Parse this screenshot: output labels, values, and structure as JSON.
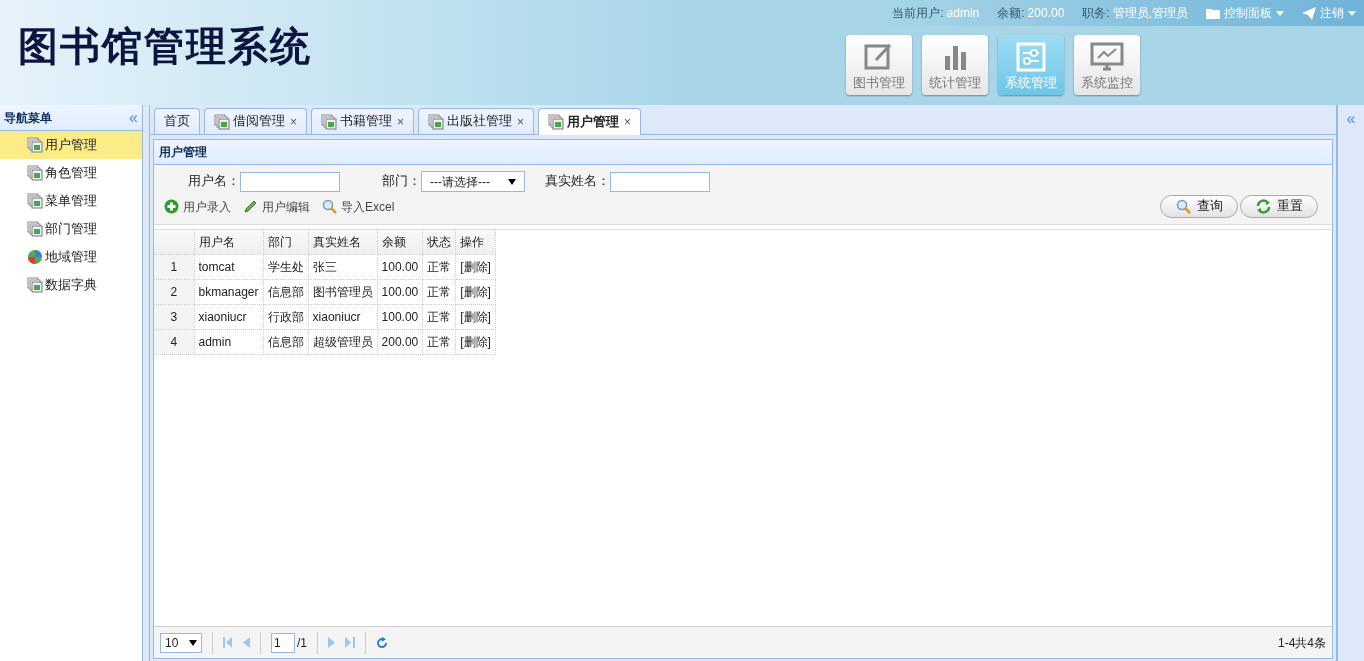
{
  "header": {
    "logo": "图书馆管理系统",
    "user_info": [
      {
        "label": "当前用户:",
        "value": "admin"
      },
      {
        "label": "余额:",
        "value": "200.00"
      },
      {
        "label": "职务:",
        "value": "管理员,管理员"
      }
    ],
    "menus": [
      {
        "kind": "folder",
        "label": "控制面板"
      },
      {
        "kind": "send",
        "label": "注销"
      }
    ],
    "modules": [
      {
        "kind": "edit",
        "label": "图书管理",
        "selected": false
      },
      {
        "kind": "chart",
        "label": "统计管理",
        "selected": false
      },
      {
        "kind": "settings",
        "label": "系统管理",
        "selected": true
      },
      {
        "kind": "monitor",
        "label": "系统监控",
        "selected": false
      }
    ]
  },
  "sidebar": {
    "title": "导航菜单",
    "collapse": "«",
    "items": [
      {
        "kind": "page",
        "label": "用户管理",
        "selected": true
      },
      {
        "kind": "page",
        "label": "角色管理",
        "selected": false
      },
      {
        "kind": "page",
        "label": "菜单管理",
        "selected": false
      },
      {
        "kind": "page",
        "label": "部门管理",
        "selected": false
      },
      {
        "kind": "globe",
        "label": "地域管理",
        "selected": false
      },
      {
        "kind": "page",
        "label": "数据字典",
        "selected": false
      }
    ]
  },
  "tabs": [
    {
      "label": "首页",
      "selected": false
    },
    {
      "label": "借阅管理",
      "selected": false,
      "close": "×"
    },
    {
      "label": "书籍管理",
      "selected": false,
      "close": "×"
    },
    {
      "label": "出版社管理",
      "selected": false,
      "close": "×"
    },
    {
      "label": "用户管理",
      "selected": true,
      "close": "×"
    }
  ],
  "right_panel": {
    "expand": "«"
  },
  "panel": {
    "title": "用户管理",
    "search": [
      {
        "kind": "text",
        "label": "用户名："
      },
      {
        "kind": "select",
        "label": "部门：",
        "value": "---请选择---"
      },
      {
        "kind": "text",
        "label": "真实姓名："
      }
    ],
    "toolbar": [
      {
        "kind": "add",
        "label": "用户录入"
      },
      {
        "kind": "edit",
        "label": "用户编辑"
      },
      {
        "kind": "search",
        "label": "导入Excel"
      }
    ],
    "buttons": [
      {
        "kind": "search",
        "label": "查询"
      },
      {
        "kind": "refresh",
        "label": "重置"
      }
    ],
    "table": {
      "columns": [
        "用户名",
        "部门",
        "真实姓名",
        "余额",
        "状态",
        "操作"
      ],
      "rows": [
        {
          "index": "1",
          "cells": [
            "tomcat",
            "学生处",
            "张三",
            "100.00",
            "正常",
            "[删除]"
          ]
        },
        {
          "index": "2",
          "cells": [
            "bkmanager",
            "信息部",
            "图书管理员",
            "100.00",
            "正常",
            "[删除]"
          ]
        },
        {
          "index": "3",
          "cells": [
            "xiaoniucr",
            "行政部",
            "xiaoniucr",
            "100.00",
            "正常",
            "[删除]"
          ]
        },
        {
          "index": "4",
          "cells": [
            "admin",
            "信息部",
            "超级管理员",
            "200.00",
            "正常",
            "[删除]"
          ]
        }
      ]
    },
    "pager": {
      "page_size": "10",
      "page": "1",
      "total_pages": "/1",
      "summary": "1-4共4条"
    }
  }
}
